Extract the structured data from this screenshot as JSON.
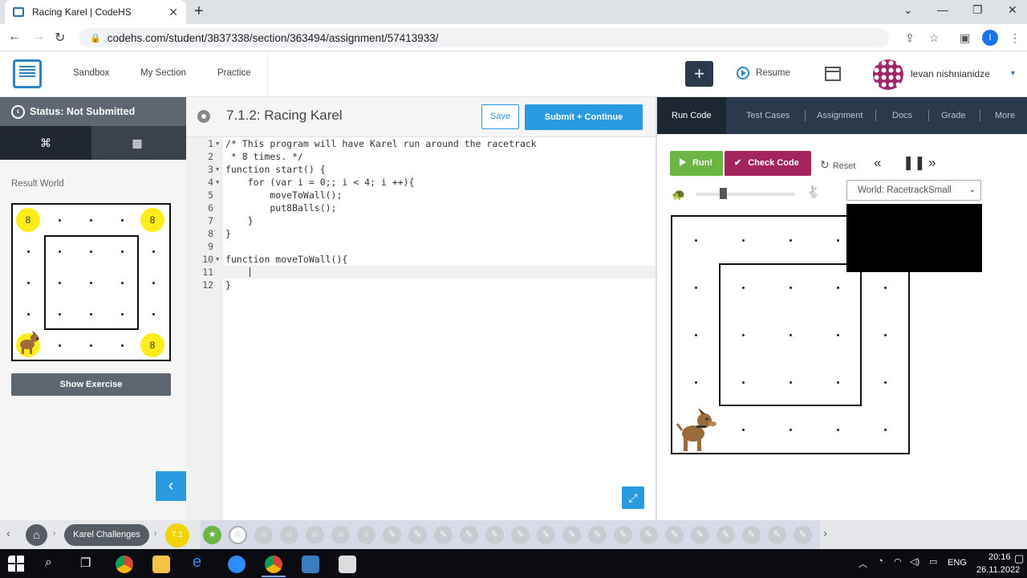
{
  "browser": {
    "tab_title": "Racing Karel | CodeHS",
    "url": "codehs.com/student/3837338/section/363494/assignment/57413933/",
    "profile_initial": "I"
  },
  "header": {
    "nav": [
      "Sandbox",
      "My Section",
      "Practice"
    ],
    "resume_label": "Resume",
    "user_name": "levan nishnianidze"
  },
  "left_panel": {
    "status": "Status: Not Submitted",
    "result_world_label": "Result World",
    "show_exercise_label": "Show Exercise",
    "balls": [
      "8",
      "8",
      "8"
    ]
  },
  "editor": {
    "title": "7.1.2: Racing Karel",
    "save_label": "Save",
    "submit_label": "Submit + Continue",
    "lines": [
      {
        "n": "1",
        "fold": true,
        "text": "/* This program will have Karel run around the racetrack"
      },
      {
        "n": "2",
        "fold": false,
        "text": " * 8 times. */"
      },
      {
        "n": "3",
        "fold": true,
        "text": "function start() {"
      },
      {
        "n": "4",
        "fold": true,
        "text": "    for (var i = 0;; i < 4; i ++){"
      },
      {
        "n": "5",
        "fold": false,
        "text": "        moveToWall();"
      },
      {
        "n": "6",
        "fold": false,
        "text": "        put8Balls();"
      },
      {
        "n": "7",
        "fold": false,
        "text": "    }"
      },
      {
        "n": "8",
        "fold": false,
        "text": "}"
      },
      {
        "n": "9",
        "fold": false,
        "text": ""
      },
      {
        "n": "10",
        "fold": true,
        "text": "function moveToWall(){"
      },
      {
        "n": "11",
        "fold": false,
        "text": ""
      },
      {
        "n": "12",
        "fold": false,
        "text": "}"
      }
    ]
  },
  "right_panel": {
    "tabs": [
      "Run Code",
      "Test Cases",
      "Assignment",
      "Docs",
      "Grade",
      "More"
    ],
    "run_label": "Run!",
    "check_label": "Check Code",
    "reset_label": "Reset",
    "world_select": "World: RacetrackSmall"
  },
  "bottom": {
    "breadcrumb": "Karel Challenges",
    "unit": "7.1"
  },
  "taskbar": {
    "lang": "ENG",
    "time": "20:16",
    "date": "26.11.2022"
  }
}
